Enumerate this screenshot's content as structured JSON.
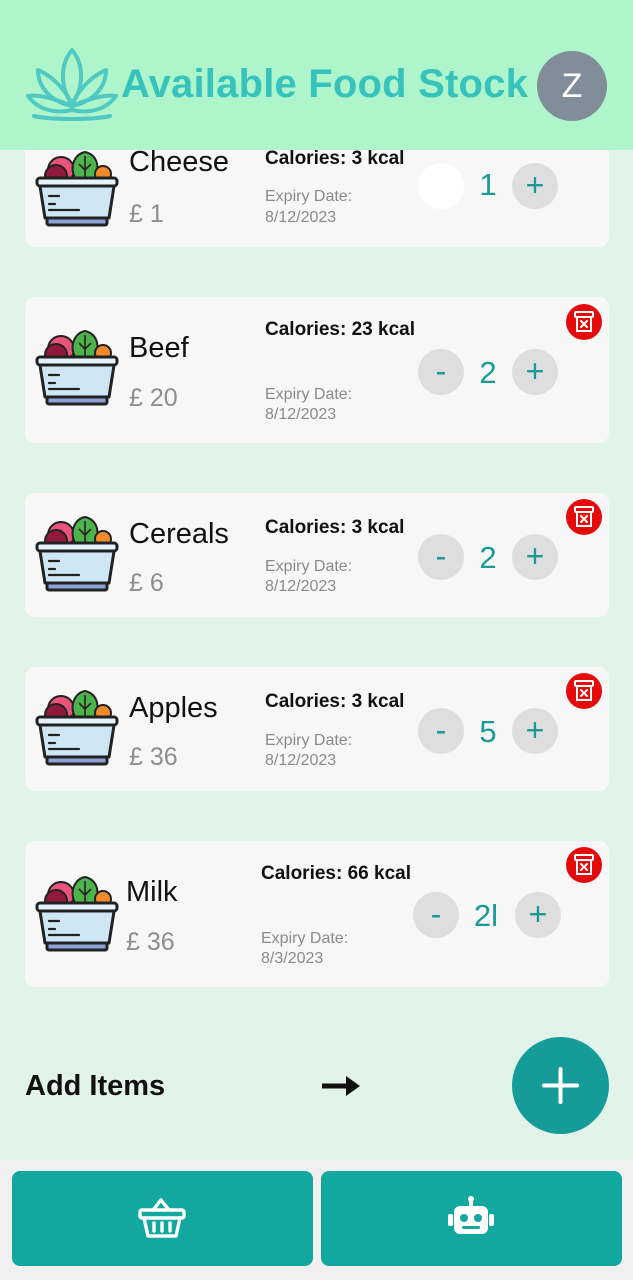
{
  "header": {
    "title": "Available Food Stock",
    "avatar_letter": "Z"
  },
  "items": [
    {
      "name": "Cheese",
      "price": "£ 1",
      "calories": "Calories: 3 kcal",
      "expiry_label": "Expiry Date:",
      "expiry_date": "8/12/2023",
      "minus": "",
      "qty": "1",
      "plus": "+"
    },
    {
      "name": "Beef",
      "price": "£ 20",
      "calories": "Calories: 23 kcal",
      "expiry_label": "Expiry Date:",
      "expiry_date": "8/12/2023",
      "minus": "-",
      "qty": "2",
      "plus": "+"
    },
    {
      "name": "Cereals",
      "price": "£ 6",
      "calories": "Calories: 3 kcal",
      "expiry_label": "Expiry Date:",
      "expiry_date": "8/12/2023",
      "minus": "-",
      "qty": "2",
      "plus": "+"
    },
    {
      "name": "Apples",
      "price": "£ 36",
      "calories": "Calories: 3 kcal",
      "expiry_label": "Expiry Date:",
      "expiry_date": "8/12/2023",
      "minus": "-",
      "qty": "5",
      "plus": "+"
    },
    {
      "name": "Milk",
      "price": "£ 36",
      "calories": "Calories: 66 kcal",
      "expiry_label": "Expiry Date:",
      "expiry_date": "8/3/2023",
      "minus": "-",
      "qty": "2l",
      "plus": "+"
    }
  ],
  "add_items": {
    "label": "Add Items",
    "arrow_icon": "right-arrow-icon",
    "fab_icon": "plus-icon"
  },
  "bottom_nav": [
    {
      "icon": "basket-icon"
    },
    {
      "icon": "robot-icon"
    }
  ],
  "colors": {
    "accent": "#169c98",
    "header_bg": "#aff5cc",
    "title": "#35c3bc",
    "delete": "#e40b0b"
  }
}
